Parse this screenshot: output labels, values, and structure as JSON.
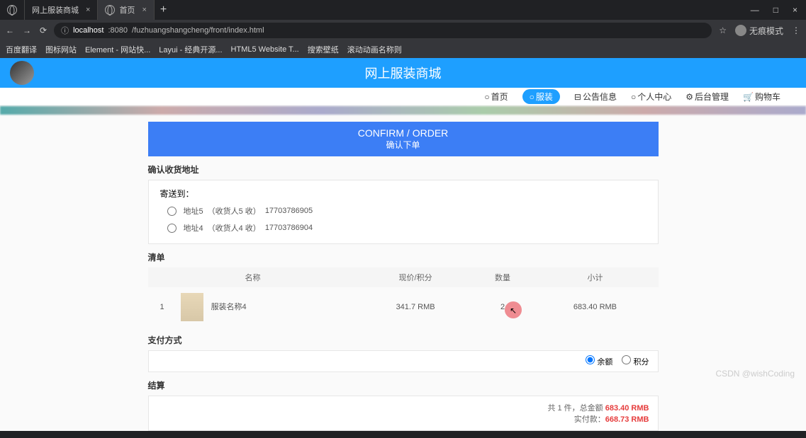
{
  "browser": {
    "tabs": [
      {
        "title": "网上服装商城",
        "active": false
      },
      {
        "title": "首页",
        "active": true
      }
    ],
    "url_host": "localhost",
    "url_port": ":8080",
    "url_path": "/fuzhuangshangcheng/front/index.html",
    "incognito_label": "无痕模式",
    "bookmarks": [
      "百度翻译",
      "图标网站",
      "Element - 网站快...",
      "Layui - 经典开源...",
      "HTML5 Website T...",
      "搜索壁纸",
      "滚动动画名称则"
    ]
  },
  "site": {
    "title": "网上服装商城",
    "nav": [
      {
        "icon": "○",
        "label": "首页"
      },
      {
        "icon": "○",
        "label": "服装"
      },
      {
        "icon": "⊟",
        "label": "公告信息"
      },
      {
        "icon": "○",
        "label": "个人中心"
      },
      {
        "icon": "⚙",
        "label": "后台管理"
      },
      {
        "icon": "🛒",
        "label": "购物车"
      }
    ]
  },
  "order": {
    "header_en": "CONFIRM / ORDER",
    "header_cn": "确认下单",
    "addr_section_title": "确认收货地址",
    "send_to_label": "寄送到：",
    "addresses": [
      {
        "name": "地址5",
        "receiver": "（收货人5 收）",
        "phone": "17703786905"
      },
      {
        "name": "地址4",
        "receiver": "（收货人4 收）",
        "phone": "17703786904"
      }
    ],
    "list_title": "清单",
    "columns": {
      "name": "名称",
      "price": "现价/积分",
      "qty": "数量",
      "subtotal": "小计"
    },
    "items": [
      {
        "idx": "1",
        "name": "服装名称4",
        "price": "341.7 RMB",
        "qty": "2",
        "subtotal": "683.40 RMB"
      }
    ],
    "pay_title": "支付方式",
    "pay_balance": "余额",
    "pay_points": "积分",
    "settle_title": "结算",
    "summary_prefix": "共 1 件，总金额",
    "summary_total": "683.40 RMB",
    "summary_pay_label": "实付款：",
    "summary_pay": "668.73 RMB"
  },
  "watermark": "CSDN @wishCoding"
}
